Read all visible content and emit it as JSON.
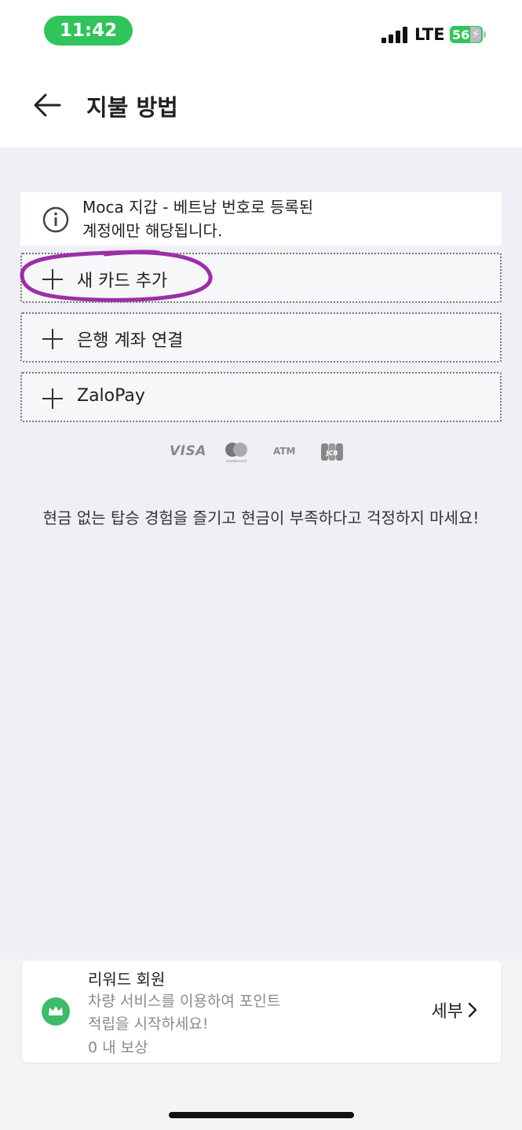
{
  "status_bar": {
    "time": "11:42",
    "network": "LTE",
    "battery": "56"
  },
  "header": {
    "title": "지불 방법"
  },
  "info": {
    "line1": "Moca 지갑 - 베트남 번호로 등록된",
    "line2": "계정에만 해당됩니다."
  },
  "options": [
    {
      "label": "새 카드 추가"
    },
    {
      "label": "은행 계좌 연결"
    },
    {
      "label": "ZaloPay"
    }
  ],
  "card_logos": {
    "visa": "VISA",
    "atm": "ATM",
    "mastercard_caption": "mastercard",
    "jcb": "JCB"
  },
  "promo_text": "현금 없는 탑승 경험을 즐기고 현금이 부족하다고 걱정하지 마세요!",
  "rewards": {
    "title": "리워드 회원",
    "desc_line1": "차량 서비스를 이용하여 포인트",
    "desc_line2": "적립을 시작하세요!",
    "count": "0 내 보상",
    "details_label": "세부"
  },
  "colors": {
    "status_green": "#2fc55b",
    "annotation_purple": "#9b2fa6",
    "crown_green": "#3dbb6b"
  }
}
